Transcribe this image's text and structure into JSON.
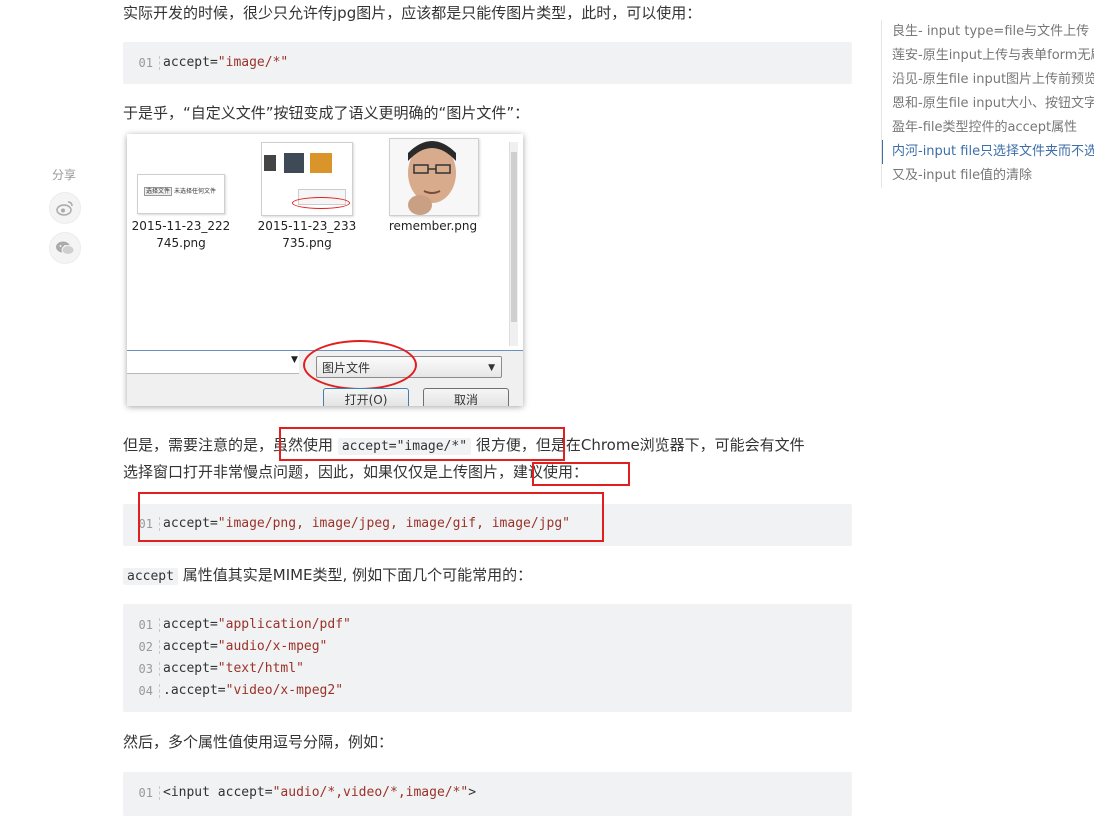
{
  "article": {
    "p1": "实际开发的时候，很少只允许传jpg图片，应该都是只能传图片类型，此时，可以使用：",
    "code1": {
      "line_numbers": [
        "01"
      ],
      "attr": "accept=",
      "value": "\"image/*\""
    },
    "p2": "于是乎，“自定义文件”按钮变成了语义更明确的“图片文件”：",
    "dialog": {
      "files": [
        {
          "name_line1": "2015-11-23_222",
          "name_line2": "745.png"
        },
        {
          "name_line1": "2015-11-23_233",
          "name_line2": "735.png"
        },
        {
          "name_line1": "remember.png",
          "name_line2": ""
        }
      ],
      "thumb1_button_text": "选择文件",
      "thumb1_caption": "未选择任何文件",
      "file_type_filter": "图片文件",
      "open_button": "打开(O)",
      "cancel_button": "取消"
    },
    "p3": {
      "pre": "但是，需要注意的是，",
      "hl1": "虽然使用",
      "inline_code1": "accept=\"image/*\"",
      "hl1_tail": "很方便，",
      "rest_line1": "但是在Chrome浏览器下，可能会有文件",
      "line2": "选择窗口打开非常慢点问题，因此，如果仅仅是上传图片，",
      "hl2": "建议使用："
    },
    "code2": {
      "line_numbers": [
        "01"
      ],
      "attr": "accept=",
      "value": "\"image/png, image/jpeg, image/gif, image/jpg\""
    },
    "p4": {
      "inline_code": "accept",
      "text": "属性值其实是MIME类型, 例如下面几个可能常用的："
    },
    "code3": {
      "lines": [
        {
          "n": "01",
          "attr": "accept=",
          "value": "\"application/pdf\""
        },
        {
          "n": "02",
          "attr": "accept=",
          "value": "\"audio/x-mpeg\""
        },
        {
          "n": "03",
          "attr": "accept=",
          "value": "\"text/html\""
        },
        {
          "n": "04",
          "attr": ".accept=",
          "value": "\"video/x-mpeg2\""
        }
      ]
    },
    "p5": "然后，多个属性值使用逗号分隔，例如：",
    "code4": {
      "line_numbers": [
        "01"
      ],
      "tag_open": "<input ",
      "attr": "accept=",
      "value": "\"audio/*,video/*,image/*\"",
      "tag_close": ">"
    }
  },
  "share": {
    "label": "分享",
    "icons": [
      "weibo-icon",
      "wechat-icon"
    ]
  },
  "toc": {
    "items": [
      "良生- input type=file与文件上传",
      "莲安-原生input上传与表单form无刷新",
      "沿见-原生file input图片上传前预览",
      "恩和-原生file input大小、按钮文字",
      "盈年-file类型控件的accept属性",
      "内河-input file只选择文件夹而不选文件",
      "又及-input file值的清除"
    ],
    "active_index": 5
  },
  "colors": {
    "highlight": "#e11f1f",
    "code_bg": "#f1f2f4",
    "string": "#9b3229",
    "toc_active": "#3c6ea8"
  }
}
